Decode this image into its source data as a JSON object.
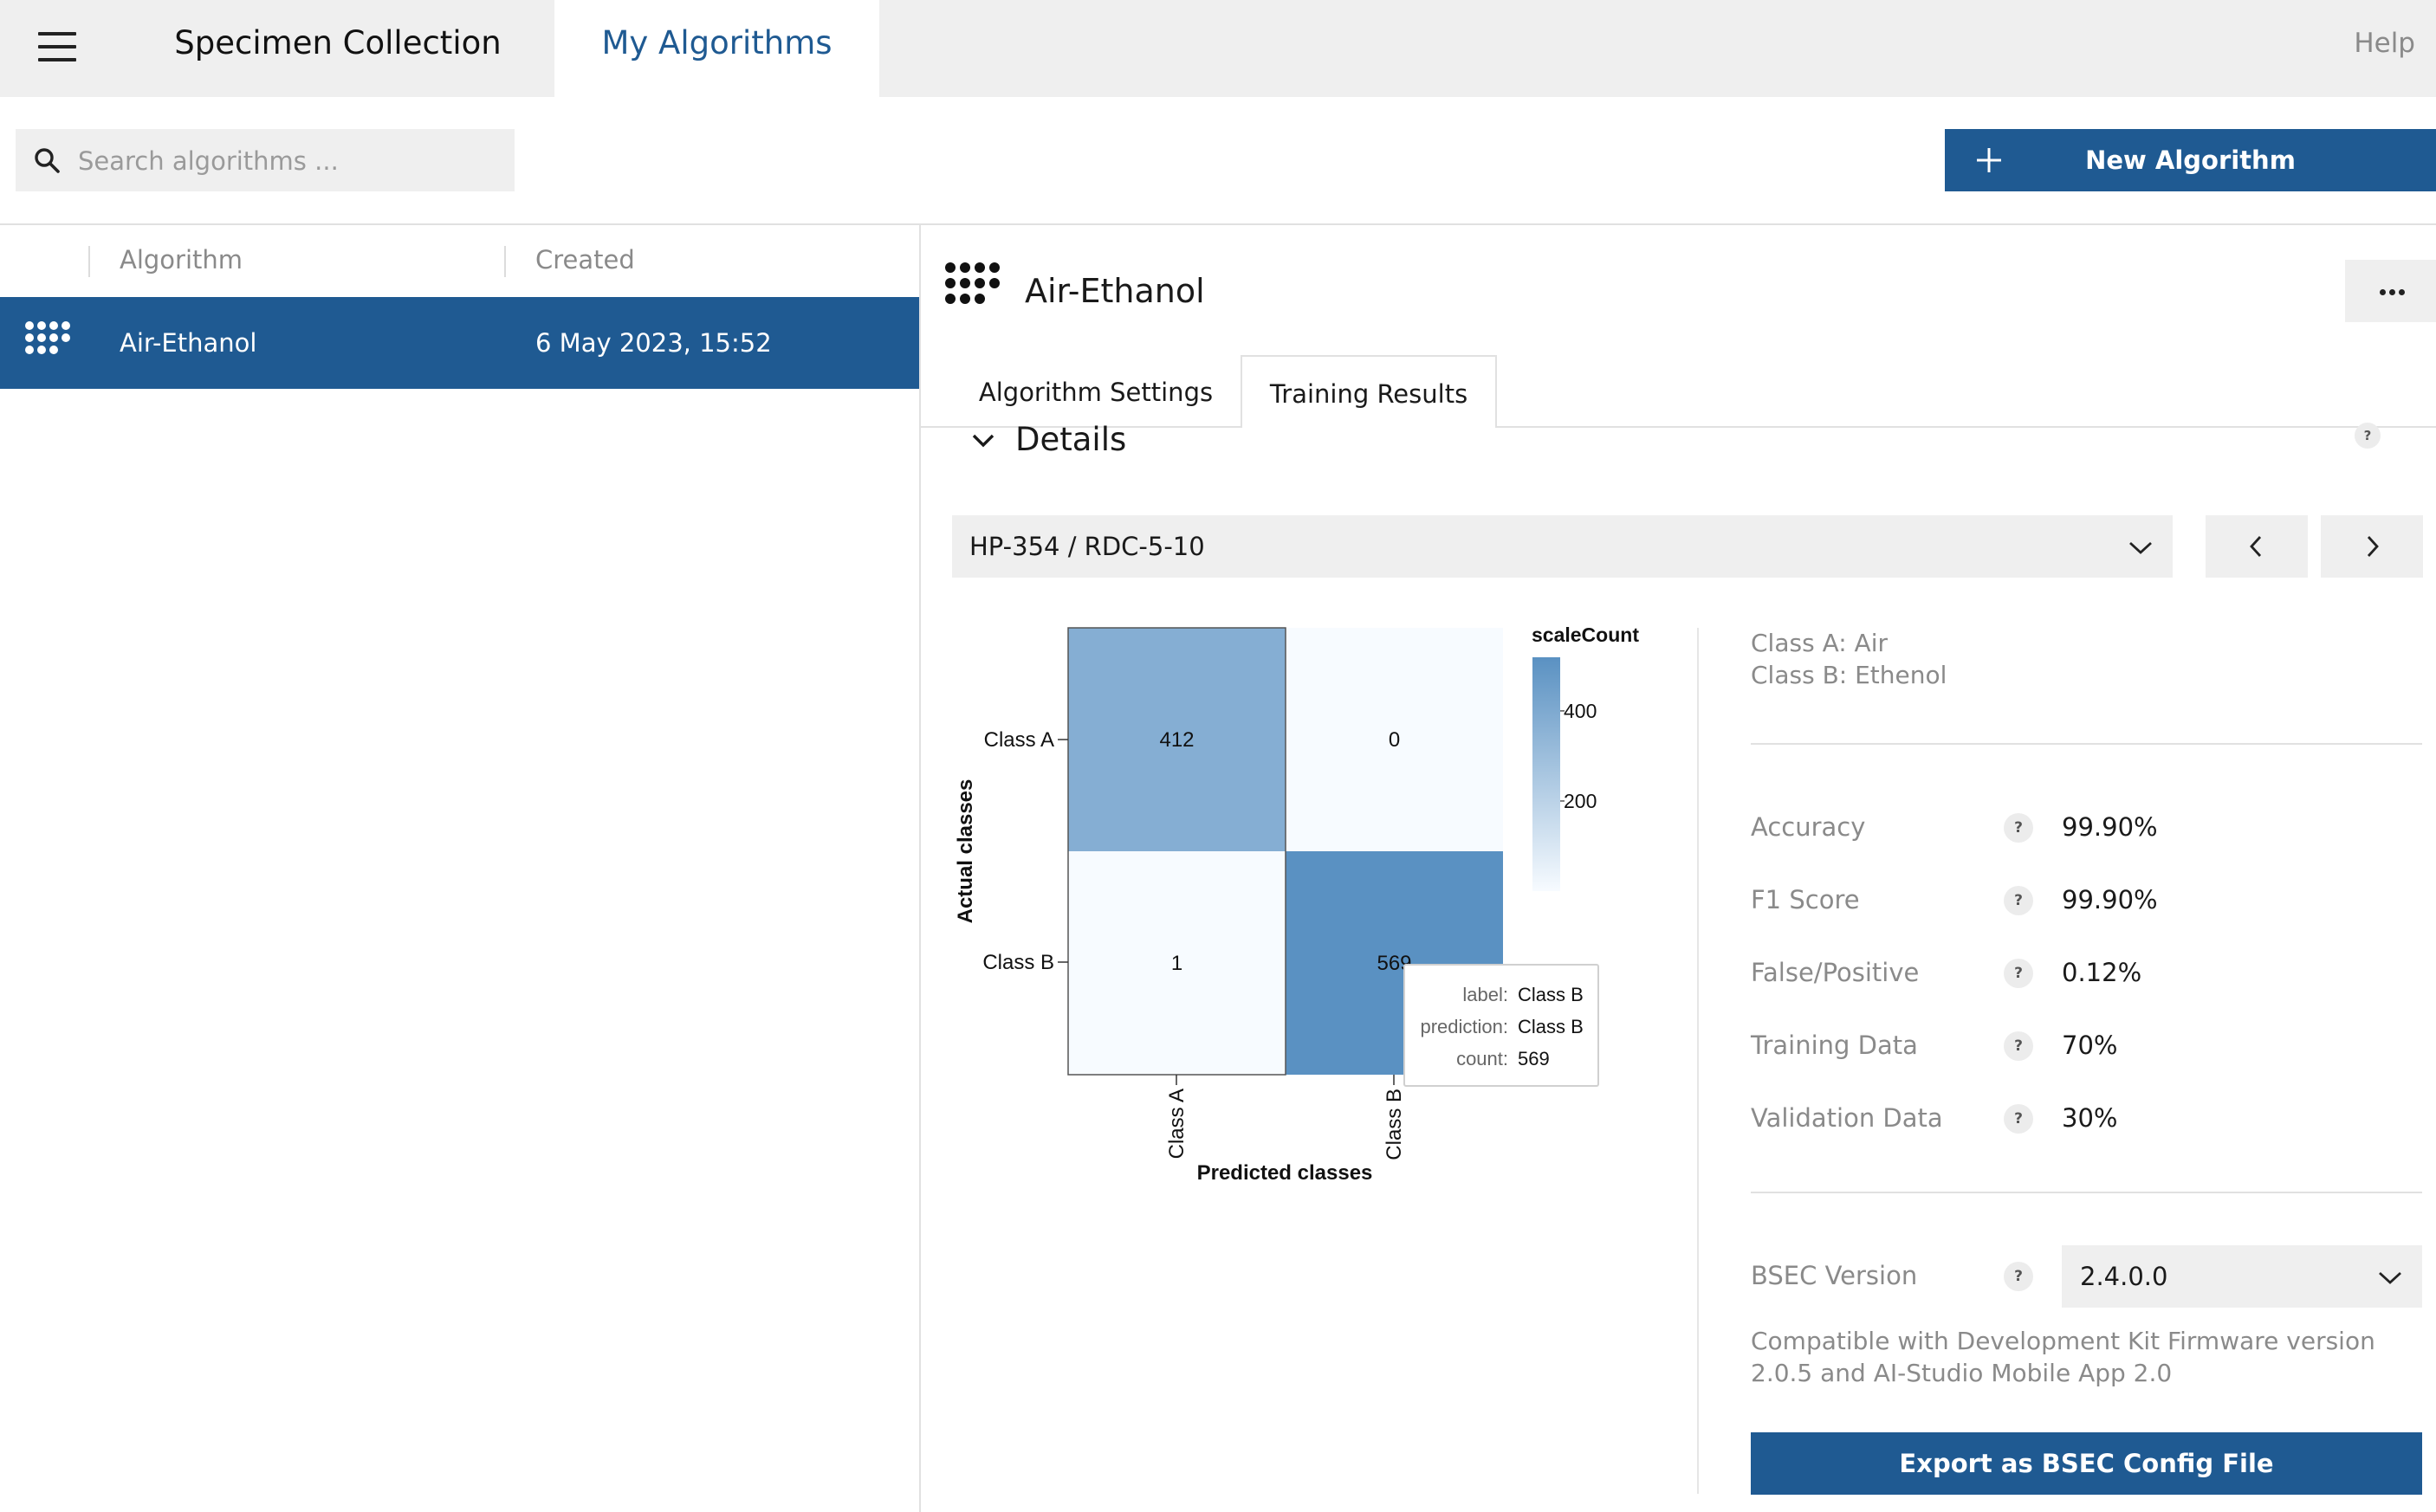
{
  "nav": {
    "menu_icon": "hamburger-icon",
    "tabs": [
      "Specimen Collection",
      "My Algorithms"
    ],
    "active_tab": "My Algorithms",
    "help": "Help"
  },
  "search": {
    "placeholder": "Search algorithms ...",
    "value": "",
    "icon": "search-icon"
  },
  "new_button": {
    "label": "New Algorithm",
    "icon": "plus-icon"
  },
  "list": {
    "headers": [
      "Algorithm",
      "Created"
    ],
    "rows": [
      {
        "name": "Air-Ethanol",
        "created": "6 May 2023, 15:52",
        "icon": "algorithm-grid-icon",
        "selected": true
      }
    ]
  },
  "detail": {
    "title": "Air-Ethanol",
    "more_icon": "more-horizontal-icon",
    "tabs": [
      "Algorithm Settings",
      "Training Results"
    ],
    "active_tab": "Training Results",
    "section_title": "Details",
    "help_mark": "?",
    "sensor": {
      "value": "HP-354 / RDC-5-10"
    }
  },
  "colors": {
    "primary": "#1f5a92",
    "panel": "#efefef",
    "heat_low": "#f7fbff",
    "heat_high": "#5a91c2"
  },
  "chart_data": {
    "type": "heatmap",
    "xlabel": "Predicted classes",
    "ylabel": "Actual classes",
    "x_categories": [
      "Class A",
      "Class B"
    ],
    "y_categories": [
      "Class A",
      "Class B"
    ],
    "cells": [
      {
        "actual": "Class A",
        "predicted": "Class A",
        "count": 412
      },
      {
        "actual": "Class A",
        "predicted": "Class B",
        "count": 0
      },
      {
        "actual": "Class B",
        "predicted": "Class A",
        "count": 1
      },
      {
        "actual": "Class B",
        "predicted": "Class B",
        "count": 569
      }
    ],
    "legend": {
      "title": "scaleCount",
      "ticks": [
        400,
        200
      ]
    },
    "tooltip": {
      "label_key": "label:",
      "label": "Class B",
      "prediction_key": "prediction:",
      "prediction": "Class B",
      "count_key": "count:",
      "count": "569"
    }
  },
  "info": {
    "class_a": "Class A: Air",
    "class_b": "Class B: Ethenol",
    "metrics": [
      {
        "label": "Accuracy",
        "value": "99.90%"
      },
      {
        "label": "F1 Score",
        "value": "99.90%"
      },
      {
        "label": "False/Positive",
        "value": "0.12%"
      },
      {
        "label": "Training Data",
        "value": "70%"
      },
      {
        "label": "Validation Data",
        "value": "30%"
      }
    ],
    "bsec": {
      "label": "BSEC Version",
      "value": "2.4.0.0",
      "compat_line1": "Compatible with Development Kit Firmware version",
      "compat_line2": "2.0.5 and AI-Studio Mobile App 2.0"
    },
    "export_label": "Export as BSEC Config File"
  }
}
